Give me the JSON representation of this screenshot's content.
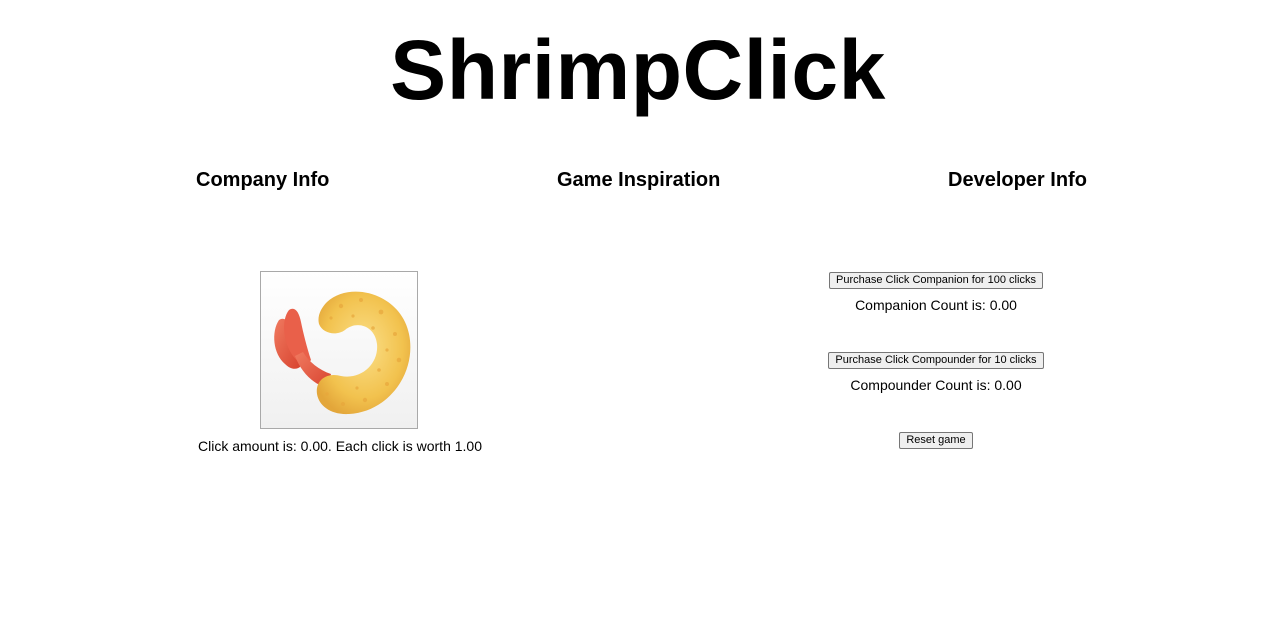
{
  "game": {
    "title": "ShrimpClick"
  },
  "nav": {
    "company_info": "Company Info",
    "game_inspiration": "Game Inspiration",
    "developer_info": "Developer Info"
  },
  "clicker": {
    "image": "fried-shrimp-emoji",
    "status_text": "Click amount is: 0.00. Each click is worth 1.00"
  },
  "upgrades": {
    "companion_button": "Purchase Click Companion for 100 clicks",
    "companion_count": "Companion Count is: 0.00",
    "compounder_button": "Purchase Click Compounder for 10 clicks",
    "compounder_count": "Compounder Count is: 0.00",
    "reset_button": "Reset game"
  },
  "colors": {
    "background": "#ffffff",
    "text": "#000000",
    "button_bg": "#efefef",
    "button_border": "#767676"
  }
}
